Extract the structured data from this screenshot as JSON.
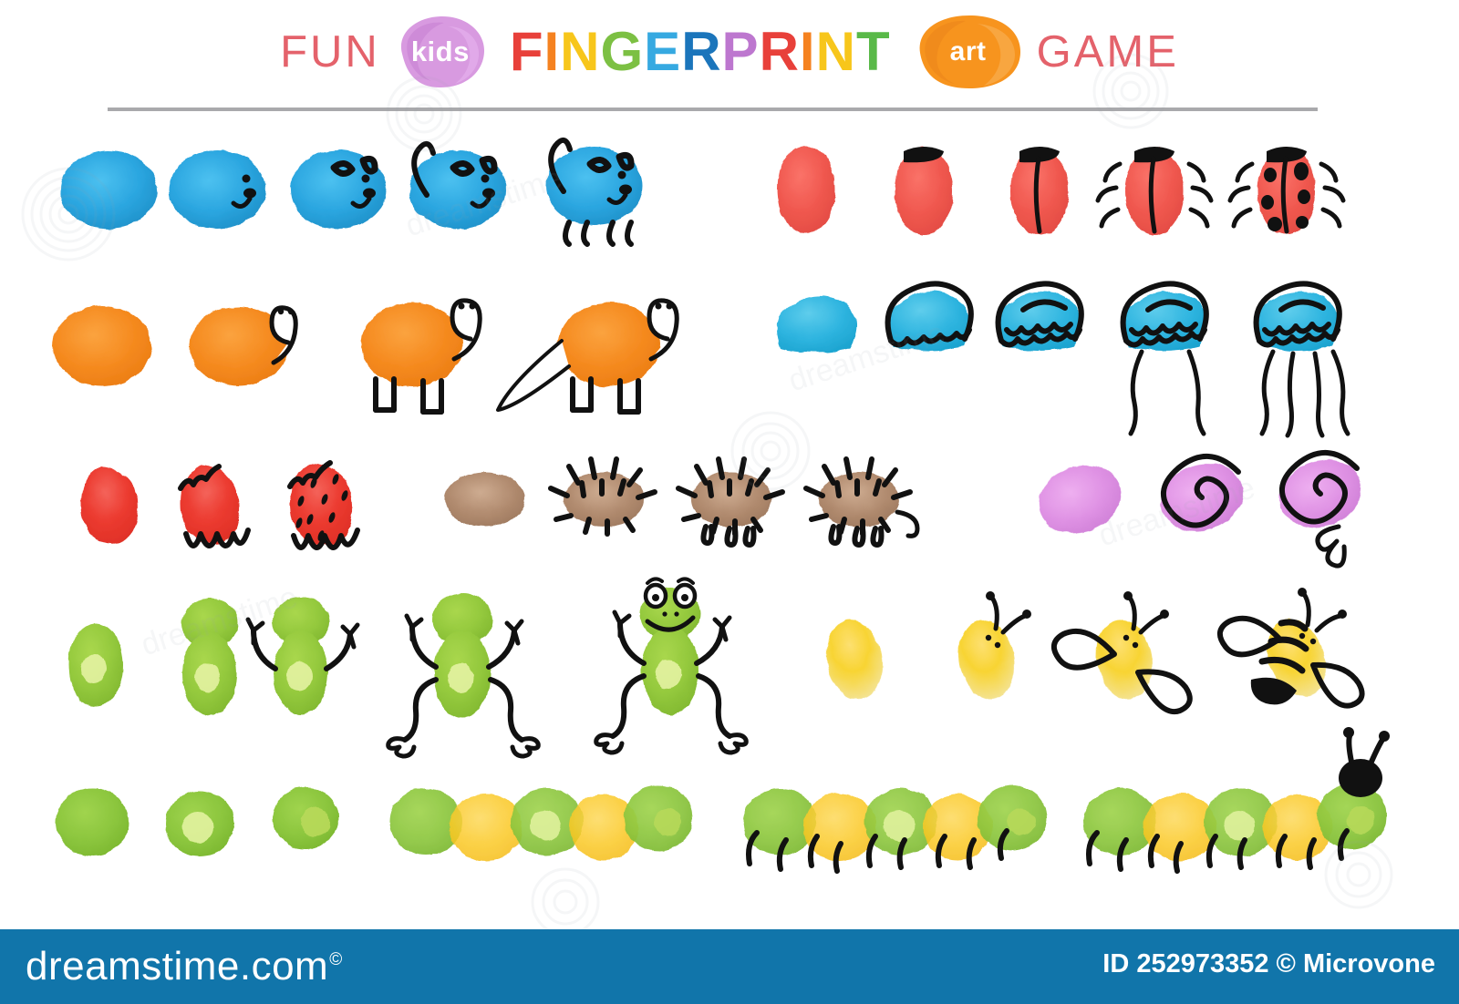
{
  "title": {
    "fun": "FUN",
    "kids": "kids",
    "fingerprint_letters": [
      {
        "ch": "F",
        "color": "#e8403a"
      },
      {
        "ch": "I",
        "color": "#f58220"
      },
      {
        "ch": "N",
        "color": "#f7c61b"
      },
      {
        "ch": "G",
        "color": "#7cc043"
      },
      {
        "ch": "E",
        "color": "#36a9e1"
      },
      {
        "ch": "R",
        "color": "#1b75bb"
      },
      {
        "ch": "P",
        "color": "#bd77cf"
      },
      {
        "ch": "R",
        "color": "#e8403a"
      },
      {
        "ch": "I",
        "color": "#f58220"
      },
      {
        "ch": "N",
        "color": "#f7c61b"
      },
      {
        "ch": "T",
        "color": "#59b948"
      }
    ],
    "art": "art",
    "game": "GAME",
    "fun_color": "#e4626b",
    "game_color": "#e4626b",
    "kids_blob_color": "#d89ae0",
    "art_blob_color": "#f7941e",
    "divider_color": "#a9a9ac"
  },
  "footer": {
    "brand": "dreamstime.com",
    "registered_mark": "©",
    "id_text": "ID 252973352 © Microvone",
    "background_color": "#1175aa",
    "text_color": "#ffffff"
  },
  "watermark": {
    "text": "dreamstime",
    "opacity": "0.09"
  },
  "palette": {
    "dog_blue": "#2ba6e0",
    "ladybug_red": "#f0584f",
    "turtle_orange": "#f58a1f",
    "jelly_blue": "#2fb5e0",
    "strawberry_red": "#ec3b30",
    "hedgehog_brown": "#b08a6e",
    "snail_purple": "#df92e4",
    "frog_green": "#94c93d",
    "frog_belly": "#e9f5a8",
    "bee_yellow": "#f8d433",
    "caterpillar_green": "#8cc63e",
    "caterpillar_yellow": "#fbc926",
    "ink_black": "#111111"
  },
  "tutorials": [
    {
      "id": "dog",
      "name": "blue-dog",
      "steps": 5,
      "color": "#2ba6e0",
      "row": 1,
      "column": "left"
    },
    {
      "id": "ladybug",
      "name": "ladybug",
      "steps": 5,
      "color": "#f0584f",
      "row": 1,
      "column": "right"
    },
    {
      "id": "turtle",
      "name": "orange-turtle",
      "steps": 4,
      "color": "#f58a1f",
      "row": 2,
      "column": "left"
    },
    {
      "id": "jellyfish",
      "name": "jellyfish",
      "steps": 5,
      "color": "#2fb5e0",
      "row": 2,
      "column": "right"
    },
    {
      "id": "strawberry",
      "name": "strawberry",
      "steps": 3,
      "color": "#ec3b30",
      "row": 3,
      "column": "left"
    },
    {
      "id": "hedgehog",
      "name": "hedgehog",
      "steps": 4,
      "color": "#b08a6e",
      "row": 3,
      "column": "center"
    },
    {
      "id": "snail",
      "name": "snail",
      "steps": 3,
      "color": "#df92e4",
      "row": 3,
      "column": "right"
    },
    {
      "id": "frog",
      "name": "frog",
      "steps": 5,
      "color": "#94c93d",
      "row": 4,
      "column": "left"
    },
    {
      "id": "bee",
      "name": "bee",
      "steps": 4,
      "color": "#f8d433",
      "row": 4,
      "column": "right"
    },
    {
      "id": "caterpillar",
      "name": "caterpillar",
      "steps": 6,
      "color": "#8cc63e",
      "row": 5,
      "column": "full"
    }
  ]
}
